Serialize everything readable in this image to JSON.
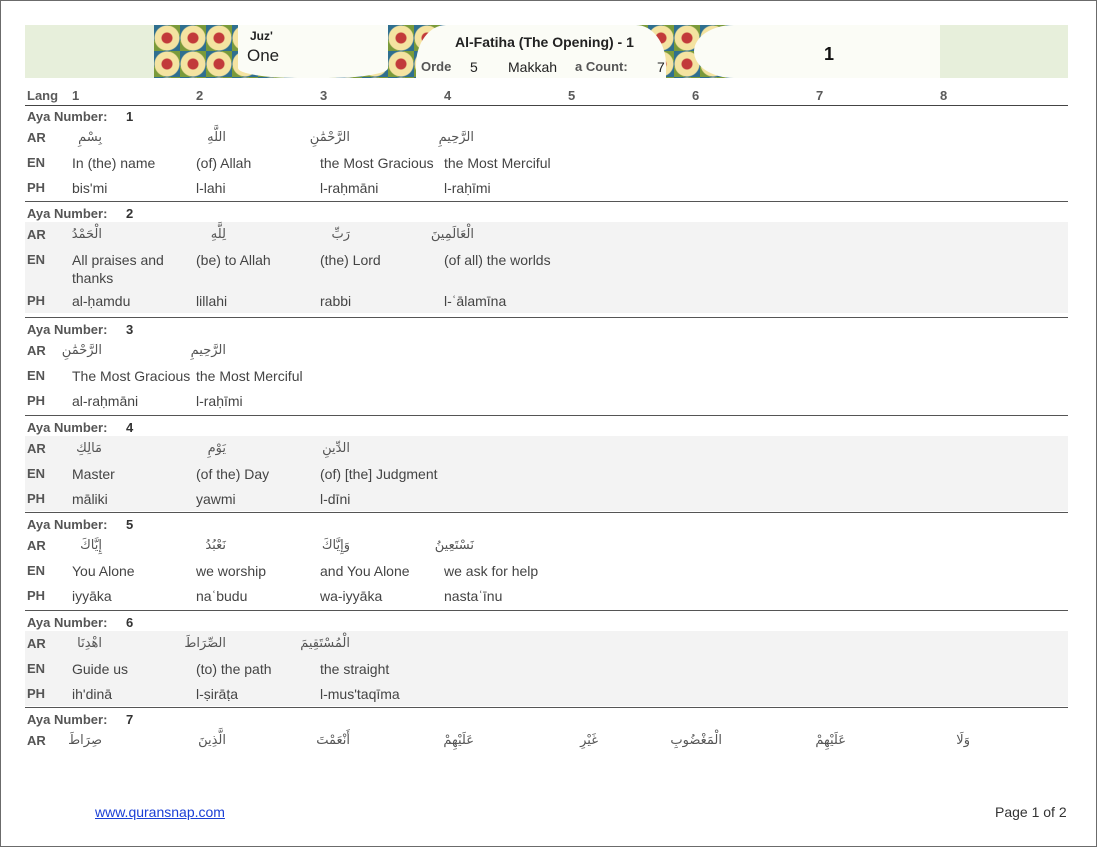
{
  "header": {
    "juz_label": "Juz'",
    "juz_value": "One",
    "surah_title": "Al-Fatiha (The Opening) - 1",
    "order_label": "Orde",
    "order_value": "5",
    "place": "Makkah",
    "count_label": "a Count:",
    "count_value": "7",
    "page_number": "1"
  },
  "column_headers": [
    "Lang",
    "1",
    "2",
    "3",
    "4",
    "5",
    "6",
    "7",
    "8"
  ],
  "aya_label": "Aya Number:",
  "ayas": [
    {
      "number": "1",
      "ar": [
        "بِسْمِ",
        "اللَّهِ",
        "الرَّحْمَٰنِ",
        "الرَّحِيمِ"
      ],
      "en": [
        "In (the) name",
        "(of) Allah",
        "the Most Gracious",
        "the Most Merciful"
      ],
      "ph": [
        "bis'mi",
        "l-lahi",
        "l-raḥmāni",
        "l-raḥīmi"
      ]
    },
    {
      "number": "2",
      "ar": [
        "الْحَمْدُ",
        "لِلَّهِ",
        "رَبِّ",
        "الْعَالَمِينَ"
      ],
      "en": [
        "All praises and thanks",
        "(be) to Allah",
        "(the) Lord",
        "(of all) the worlds"
      ],
      "ph": [
        "al-ḥamdu",
        "lillahi",
        "rabbi",
        "l-ʿālamīna"
      ]
    },
    {
      "number": "3",
      "ar": [
        "الرَّحْمَٰنِ",
        "الرَّحِيمِ"
      ],
      "en": [
        "The Most Gracious",
        "the Most Merciful"
      ],
      "ph": [
        "al-raḥmāni",
        "l-raḥīmi"
      ]
    },
    {
      "number": "4",
      "ar": [
        "مَالِكِ",
        "يَوْمِ",
        "الدِّينِ"
      ],
      "en": [
        "Master",
        "(of the) Day",
        "(of) [the] Judgment"
      ],
      "ph": [
        "māliki",
        "yawmi",
        "l-dīni"
      ]
    },
    {
      "number": "5",
      "ar": [
        "إِيَّاكَ",
        "نَعْبُدُ",
        "وَإِيَّاكَ",
        "نَسْتَعِينُ"
      ],
      "en": [
        "You Alone",
        "we worship",
        "and You Alone",
        "we ask for help"
      ],
      "ph": [
        "iyyāka",
        "naʿbudu",
        "wa-iyyāka",
        "nastaʿīnu"
      ]
    },
    {
      "number": "6",
      "ar": [
        "اهْدِنَا",
        "الصِّرَاطَ",
        "الْمُسْتَقِيمَ"
      ],
      "en": [
        "Guide us",
        "(to) the path",
        "the straight"
      ],
      "ph": [
        "ih'dinā",
        "l-ṣirāṭa",
        "l-mus'taqīma"
      ]
    },
    {
      "number": "7",
      "ar": [
        "صِرَاطَ",
        "الَّذِينَ",
        "أَنْعَمْتَ",
        "عَلَيْهِمْ",
        "غَيْرِ",
        "الْمَغْضُوبِ",
        "عَلَيْهِمْ",
        "وَلَا"
      ]
    }
  ],
  "lang_codes": {
    "ar": "AR",
    "en": "EN",
    "ph": "PH"
  },
  "footer": {
    "link": "www.quransnap.com",
    "page": "Page 1 of 2"
  },
  "colors": {
    "band": "#e7efdb",
    "banner": "#1f6a78",
    "link": "#1a3fd6",
    "shade": "#f3f3f3"
  }
}
